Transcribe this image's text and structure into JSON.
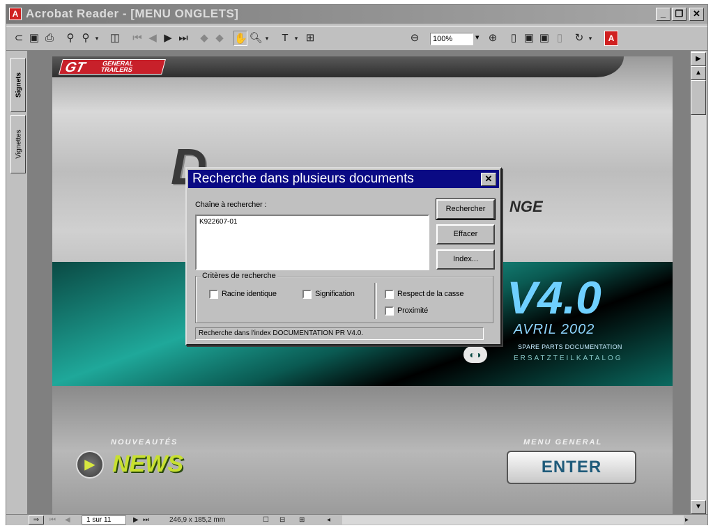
{
  "window": {
    "title": "Acrobat Reader - [MENU ONGLETS]",
    "app_icon": "A"
  },
  "window_controls": {
    "minimize": "_",
    "restore": "❐",
    "close": "✕"
  },
  "toolbar": {
    "zoom": "100%",
    "acrobat_logo": "A"
  },
  "side_tabs": {
    "bookmarks": "Signets",
    "thumbnails": "Vignettes"
  },
  "document": {
    "logo_brand": "GT",
    "logo_text": "GENERAL TRAILERS",
    "title_fragment": "D",
    "subtitle_fragment": "NGE",
    "version": "V4.0",
    "date": "AVRIL 2002",
    "spare_parts": "SPARE PARTS DOCUMENTATION",
    "ersatz": "ERSATZTEILKATALOG",
    "news_heading": "NOUVEAUTÉS",
    "news_button": "NEWS",
    "menu_heading": "MENU GENERAL",
    "enter_button": "ENTER"
  },
  "dialog": {
    "title": "Recherche dans plusieurs documents",
    "search_label": "Chaîne à rechercher :",
    "search_value": "K922607-01",
    "buttons": {
      "search": "Rechercher",
      "clear": "Effacer",
      "index": "Index..."
    },
    "criteria_label": "Critères de recherche",
    "options": [
      "Racine identique",
      "Signification",
      "Respect de la casse",
      "Proximité"
    ],
    "status": "Recherche dans l'index DOCUMENTATION PR V4.0."
  },
  "statusbar": {
    "page": "1 sur 11",
    "dimensions": "246,9 x 185,2 mm"
  }
}
